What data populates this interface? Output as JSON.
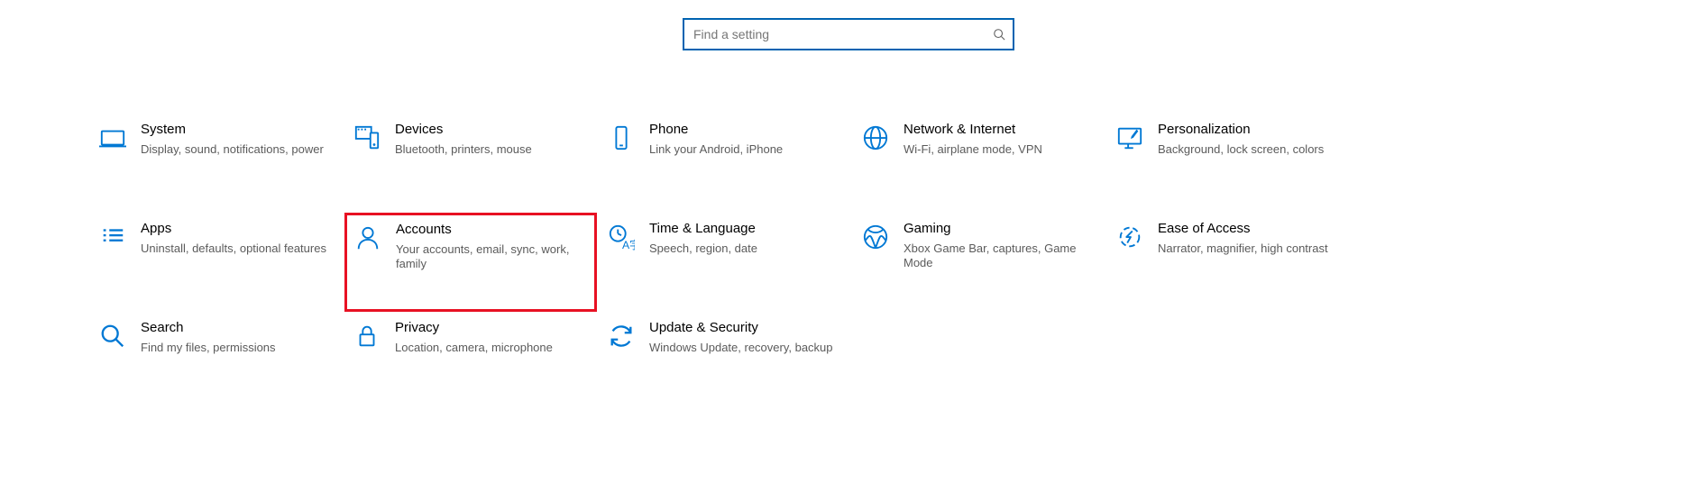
{
  "search": {
    "placeholder": "Find a setting"
  },
  "tiles": [
    {
      "id": "system",
      "title": "System",
      "desc": "Display, sound, notifications, power",
      "highlighted": false
    },
    {
      "id": "devices",
      "title": "Devices",
      "desc": "Bluetooth, printers, mouse",
      "highlighted": false
    },
    {
      "id": "phone",
      "title": "Phone",
      "desc": "Link your Android, iPhone",
      "highlighted": false
    },
    {
      "id": "network",
      "title": "Network & Internet",
      "desc": "Wi-Fi, airplane mode, VPN",
      "highlighted": false
    },
    {
      "id": "personalization",
      "title": "Personalization",
      "desc": "Background, lock screen, colors",
      "highlighted": false
    },
    {
      "id": "apps",
      "title": "Apps",
      "desc": "Uninstall, defaults, optional features",
      "highlighted": false
    },
    {
      "id": "accounts",
      "title": "Accounts",
      "desc": "Your accounts, email, sync, work, family",
      "highlighted": true
    },
    {
      "id": "time",
      "title": "Time & Language",
      "desc": "Speech, region, date",
      "highlighted": false
    },
    {
      "id": "gaming",
      "title": "Gaming",
      "desc": "Xbox Game Bar, captures, Game Mode",
      "highlighted": false
    },
    {
      "id": "ease",
      "title": "Ease of Access",
      "desc": "Narrator, magnifier, high contrast",
      "highlighted": false
    },
    {
      "id": "search",
      "title": "Search",
      "desc": "Find my files, permissions",
      "highlighted": false
    },
    {
      "id": "privacy",
      "title": "Privacy",
      "desc": "Location, camera, microphone",
      "highlighted": false
    },
    {
      "id": "update",
      "title": "Update & Security",
      "desc": "Windows Update, recovery, backup",
      "highlighted": false
    }
  ]
}
